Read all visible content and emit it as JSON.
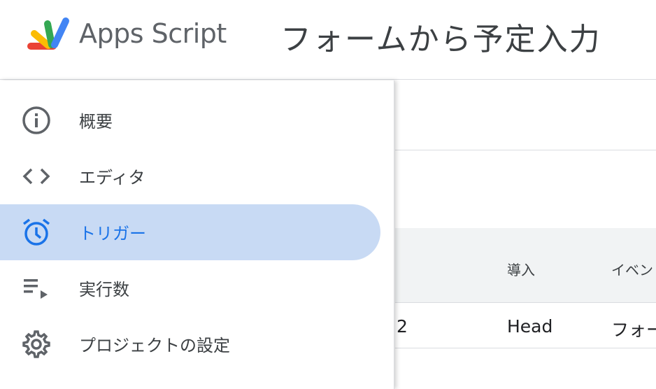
{
  "header": {
    "brand": "Apps Script",
    "project_title": "フォームから予定入力",
    "logo_icon": "apps-script-logo-icon"
  },
  "sidebar": {
    "items": [
      {
        "label": "概要",
        "icon": "info-icon",
        "active": false
      },
      {
        "label": "エディタ",
        "icon": "code-icon",
        "active": false
      },
      {
        "label": "トリガー",
        "icon": "alarm-clock-icon",
        "active": true
      },
      {
        "label": "実行数",
        "icon": "playlist-play-icon",
        "active": false
      },
      {
        "label": "プロジェクトの設定",
        "icon": "gear-icon",
        "active": false
      }
    ]
  },
  "table": {
    "columns": [
      "導入",
      "イベン"
    ],
    "rows": [
      {
        "col0": "2",
        "col1": "Head",
        "col2": "フォー"
      }
    ]
  },
  "colors": {
    "active_background": "#c8daf4",
    "active_text": "#1a73e8",
    "icon_gray": "#5f6368",
    "logo_blue": "#4285f4",
    "logo_green": "#34a853",
    "logo_yellow": "#fbbc04",
    "logo_red": "#ea4335"
  }
}
